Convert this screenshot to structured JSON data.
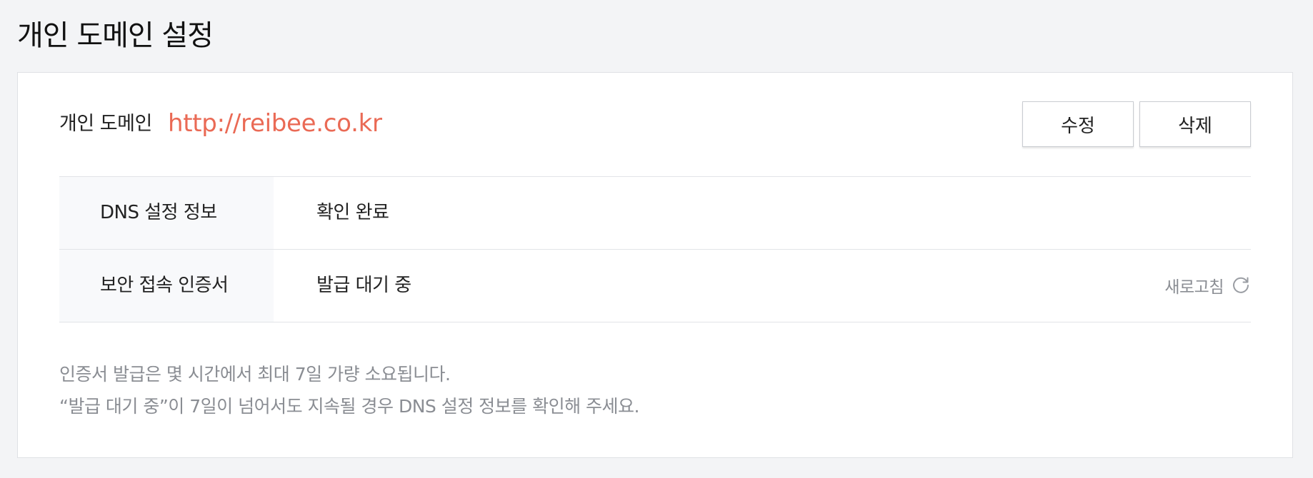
{
  "page": {
    "title": "개인 도메인 설정"
  },
  "domain": {
    "label": "개인 도메인",
    "url": "http://reibee.co.kr",
    "edit_label": "수정",
    "delete_label": "삭제"
  },
  "info_rows": [
    {
      "key": "DNS 설정 정보",
      "value": "확인 완료"
    },
    {
      "key": "보안 접속 인증서",
      "value": "발급 대기 중",
      "action_label": "새로고침",
      "action_icon": "refresh-icon"
    }
  ],
  "notes": [
    "인증서 발급은 몇 시간에서 최대 7일 가량 소요됩니다.",
    "“발급 대기 중”이 7일이 넘어서도 지속될 경우 DNS 설정 정보를 확인해 주세요."
  ],
  "colors": {
    "accent": "#ea6a55",
    "muted_text": "#8a8d93",
    "background": "#f3f4f6",
    "key_cell_bg": "#f8f9fb"
  }
}
